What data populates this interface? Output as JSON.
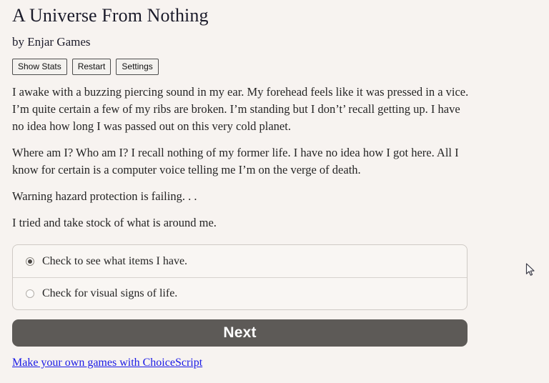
{
  "header": {
    "title": "A Universe From Nothing",
    "byline": "by Enjar Games"
  },
  "toolbar": {
    "show_stats_label": "Show Stats",
    "restart_label": "Restart",
    "settings_label": "Settings"
  },
  "story": {
    "paragraphs": [
      "I awake with a buzzing piercing sound in my ear. My forehead feels like it was pressed in a vice. I’m quite certain a few of my ribs are broken. I’m standing but I don’t’ recall getting up. I have no idea how long I was passed out on this very cold planet.",
      "Where am I? Who am I? I recall nothing of my former life. I have no idea how I got here. All I know for certain is a computer voice telling me I’m on the verge of death.",
      "Warning hazard protection is failing. . .",
      "I tried and take stock of what is around me."
    ]
  },
  "choices": {
    "options": [
      {
        "label": "Check to see what items I have.",
        "selected": true
      },
      {
        "label": "Check for visual signs of life.",
        "selected": false
      }
    ]
  },
  "next_button": {
    "label": "Next"
  },
  "footer": {
    "link_label": "Make your own games with ChoiceScript"
  },
  "colors": {
    "page_background": "#f7f3f0",
    "text": "#252525",
    "next_button_background": "#5d5a57",
    "next_button_text": "#ffffff",
    "link": "#1a1ae6",
    "choice_border": "#cfcac5"
  }
}
